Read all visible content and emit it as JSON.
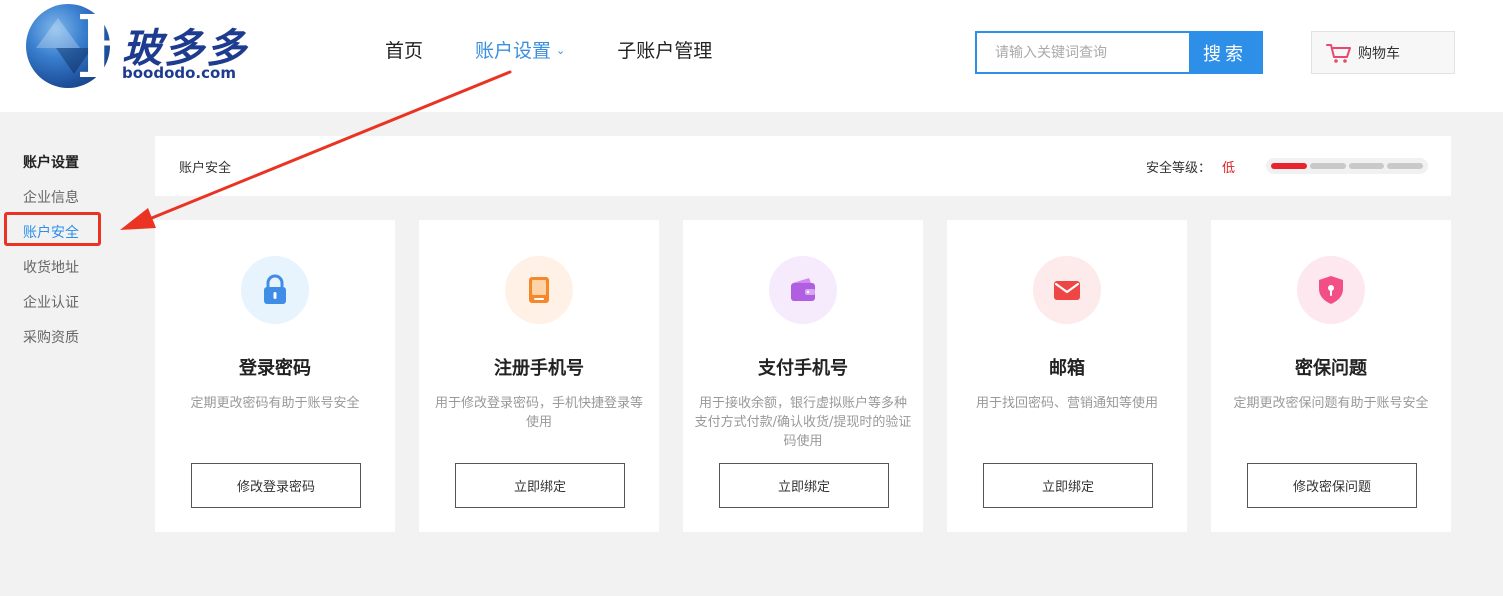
{
  "brand": {
    "cn": "玻多多",
    "en": "boododo.com"
  },
  "nav": [
    {
      "label": "首页",
      "active": false,
      "dropdown": false
    },
    {
      "label": "账户设置",
      "active": true,
      "dropdown": true
    },
    {
      "label": "子账户管理",
      "active": false,
      "dropdown": false
    }
  ],
  "search": {
    "placeholder": "请输入关键词查询",
    "button": "搜索"
  },
  "cart": {
    "label": "购物车"
  },
  "sidebar": {
    "title": "账户设置",
    "items": [
      {
        "label": "企业信息"
      },
      {
        "label": "账户安全"
      },
      {
        "label": "收货地址"
      },
      {
        "label": "企业认证"
      },
      {
        "label": "采购资质"
      }
    ],
    "active_index": 1
  },
  "topbar": {
    "title": "账户安全",
    "level_label": "安全等级：",
    "level_value": "低",
    "level_fraction": 0.25
  },
  "cards": [
    {
      "icon": "lock-icon",
      "title": "登录密码",
      "desc": "定期更改密码有助于账号安全",
      "button": "修改登录密码"
    },
    {
      "icon": "phone-icon",
      "title": "注册手机号",
      "desc": "用于修改登录密码，手机快捷登录等使用",
      "button": "立即绑定"
    },
    {
      "icon": "wallet-icon",
      "title": "支付手机号",
      "desc": "用于接收余额，银行虚拟账户等多种支付方式付款/确认收货/提现时的验证码使用",
      "button": "立即绑定"
    },
    {
      "icon": "mail-icon",
      "title": "邮箱",
      "desc": "用于找回密码、营销通知等使用",
      "button": "立即绑定"
    },
    {
      "icon": "shield-icon",
      "title": "密保问题",
      "desc": "定期更改密保问题有助于账号安全",
      "button": "修改密保问题"
    }
  ],
  "colors": {
    "primary": "#2e8fe8",
    "danger": "#e8252e",
    "annotation": "#ea3323"
  }
}
